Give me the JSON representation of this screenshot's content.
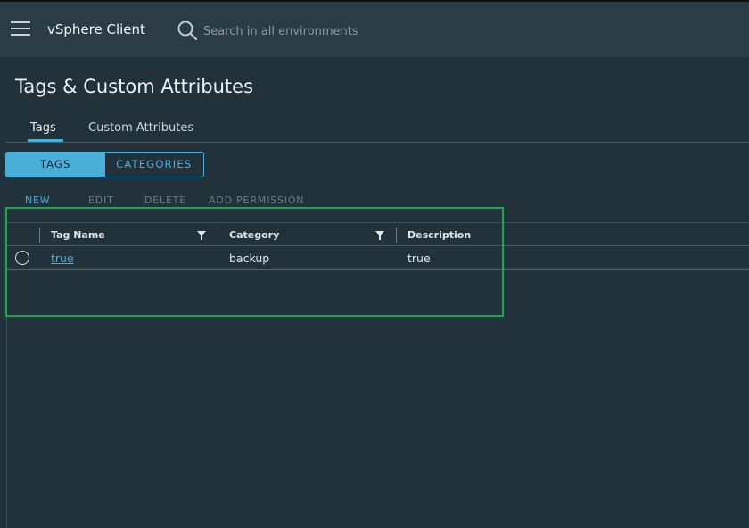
{
  "header": {
    "app_title": "vSphere Client",
    "search_placeholder": "Search in all environments"
  },
  "page": {
    "title": "Tags & Custom Attributes"
  },
  "tabs": [
    {
      "label": "Tags",
      "active": true
    },
    {
      "label": "Custom Attributes",
      "active": false
    }
  ],
  "segmented": {
    "tags_label": "TAGS",
    "categories_label": "CATEGORIES",
    "selected": "TAGS"
  },
  "actions": {
    "new": "NEW",
    "edit": "EDIT",
    "delete": "DELETE",
    "add_permission": "ADD PERMISSION"
  },
  "grid": {
    "columns": [
      "Tag Name",
      "Category",
      "Description"
    ],
    "rows": [
      {
        "tag_name": "true",
        "category": "backup",
        "description": "true"
      }
    ]
  },
  "colors": {
    "accent": "#49afd9",
    "header_bg": "#2b3c46",
    "page_bg": "#22323b",
    "highlight": "#1fa64a"
  },
  "icons": {
    "menu": "hamburger-menu-icon",
    "search": "search-icon",
    "filter": "filter-icon"
  }
}
